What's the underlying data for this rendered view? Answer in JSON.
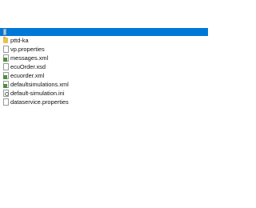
{
  "colors": {
    "selection": "#0078d7",
    "text": "#111111",
    "xml_icon": "#4f8f3a",
    "folder_icon": "#e8c24e"
  },
  "files": [
    {
      "name": "",
      "icon": "file-icon",
      "selected": true
    },
    {
      "name": "pttd-ka",
      "icon": "folder-icon"
    },
    {
      "name": "vp.properties",
      "icon": "file-icon"
    },
    {
      "name": "messages.xml",
      "icon": "xml-file-icon"
    },
    {
      "name": "ecuOrder.xsd",
      "icon": "file-icon"
    },
    {
      "name": "ecuorder.xml",
      "icon": "xml-file-icon"
    },
    {
      "name": "defaultsimulations.xml",
      "icon": "xml-file-icon"
    },
    {
      "name": "default-simulation.ini",
      "icon": "settings-file-icon"
    },
    {
      "name": "dataservice.properties",
      "icon": "file-icon"
    }
  ]
}
